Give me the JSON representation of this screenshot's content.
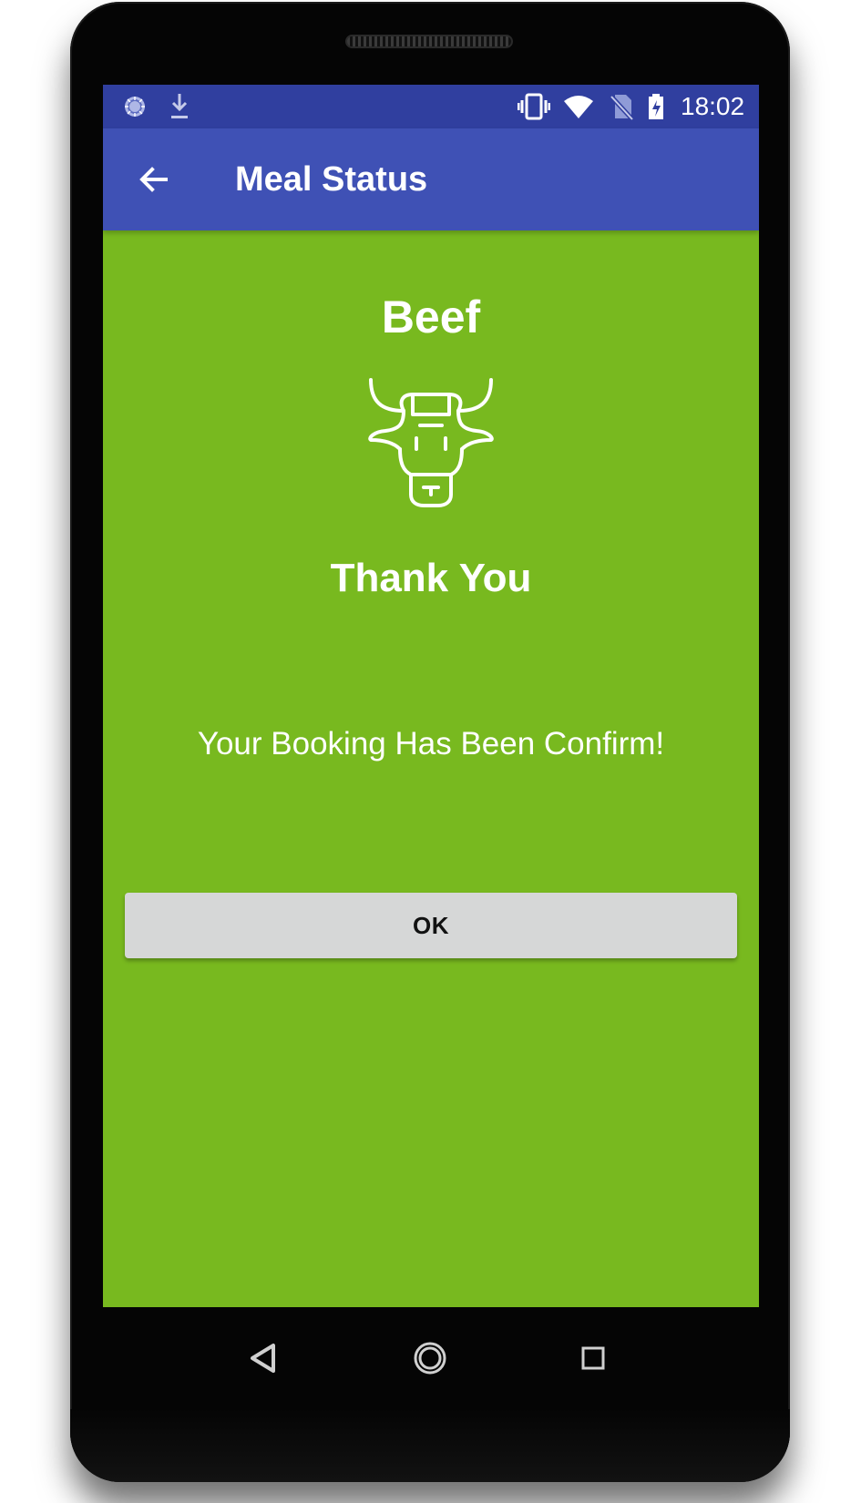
{
  "status_bar": {
    "time": "18:02",
    "left_icons": [
      "loading-icon",
      "download-icon"
    ],
    "right_icons": [
      "vibrate-icon",
      "wifi-icon",
      "no-sim-icon",
      "battery-charging-icon"
    ]
  },
  "app_bar": {
    "title": "Meal Status",
    "back_icon": "arrow-back-icon"
  },
  "main": {
    "meal_name": "Beef",
    "meal_icon": "cow-head-icon",
    "thank_you": "Thank You",
    "confirmation": "Your Booking Has Been Confirm!",
    "ok_label": "OK"
  },
  "navigation": {
    "items": [
      "back-triangle-icon",
      "home-circle-icon",
      "recents-square-icon"
    ]
  },
  "colors": {
    "status_bar": "#303f9f",
    "app_bar": "#3f51b5",
    "content_background": "#78b91f",
    "button_background": "#d6d7d7"
  }
}
